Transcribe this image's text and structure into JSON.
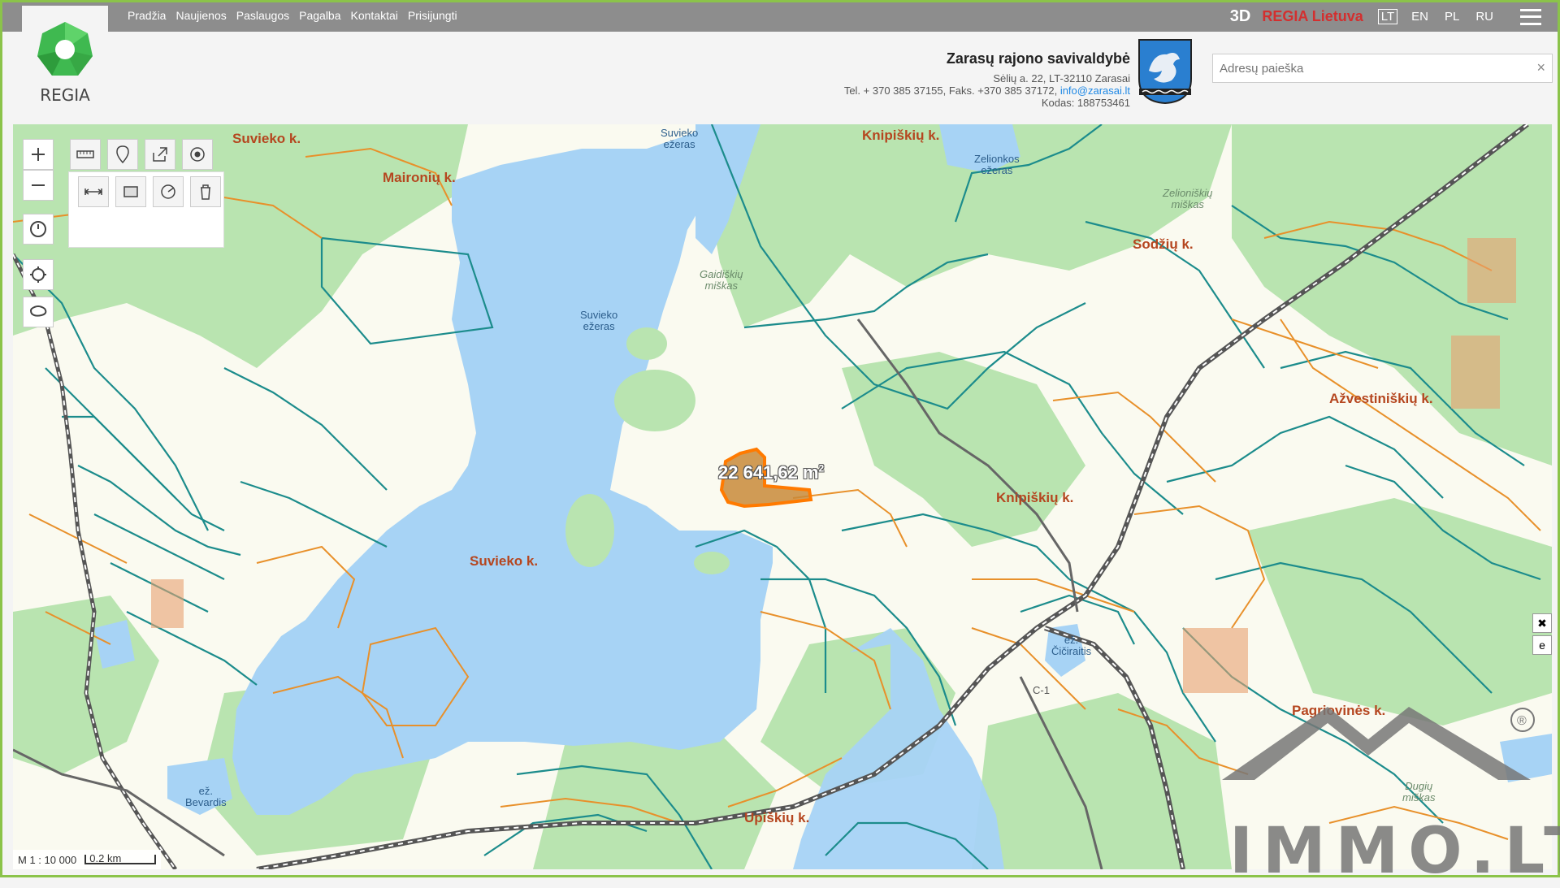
{
  "nav": {
    "items": [
      "Pradžia",
      "Naujienos",
      "Paslaugos",
      "Pagalba",
      "Kontaktai",
      "Prisijungti"
    ]
  },
  "header": {
    "logo_text": "REGIA",
    "btn_3d": "3D",
    "brand": "REGIA Lietuva",
    "languages": [
      "LT",
      "EN",
      "PL",
      "RU"
    ],
    "active_language": "LT"
  },
  "municipality": {
    "title": "Zarasų rajono savivaldybė",
    "address": "Sėlių a. 22, LT-32110 Zarasai",
    "phone_fax": "Tel. + 370 385 37155, Faks. +370 385 37172,",
    "email": "info@zarasai.lt",
    "code": "Kodas: 188753461"
  },
  "search": {
    "placeholder": "Adresų paieška",
    "clear": "×"
  },
  "map": {
    "villages": [
      "Suvieko k.",
      "Maironių k.",
      "Knipiškių k.",
      "Sodžių k.",
      "Ažvestiniškių k.",
      "Knipiškių k.",
      "Suvieko k.",
      "Pagriovinės k.",
      "Upiškių k."
    ],
    "lakes": {
      "suvieko_big": [
        "Suvieko",
        "ežeras"
      ],
      "suvieko_top": [
        "Suvieko",
        "ežeras"
      ],
      "zalionkos": [
        "Zelionkos",
        "ežeras"
      ],
      "ciciraitis": [
        "ež.",
        "Čičiraitis"
      ],
      "bevardis": [
        "ež.",
        "Bevardis"
      ]
    },
    "forests": {
      "gaidiskiu": [
        "Gaidiškių",
        "miškas"
      ],
      "zelioniskiu": [
        "Zelioniškių",
        "miškas"
      ],
      "dugiu": [
        "Dugių",
        "miškas"
      ]
    },
    "selected_area": "22 641,62 m",
    "selected_area_unit_sup": "2",
    "road_label": "C-1",
    "scale": "M 1 : 10 000",
    "scale_bar": "0.2 km"
  },
  "watermark": {
    "text": "IMMO.LT",
    "registered": "®"
  },
  "colors": {
    "water": "#a7d3f5",
    "forest": "#b9e4b0",
    "open_land": "#fafaf0",
    "parcel_teal": "#1c8c8c",
    "parcel_orange": "#e8902a",
    "village_label": "#b5461f",
    "selected_fill": "#c88a3a",
    "selected_stroke": "#ff7a00"
  }
}
